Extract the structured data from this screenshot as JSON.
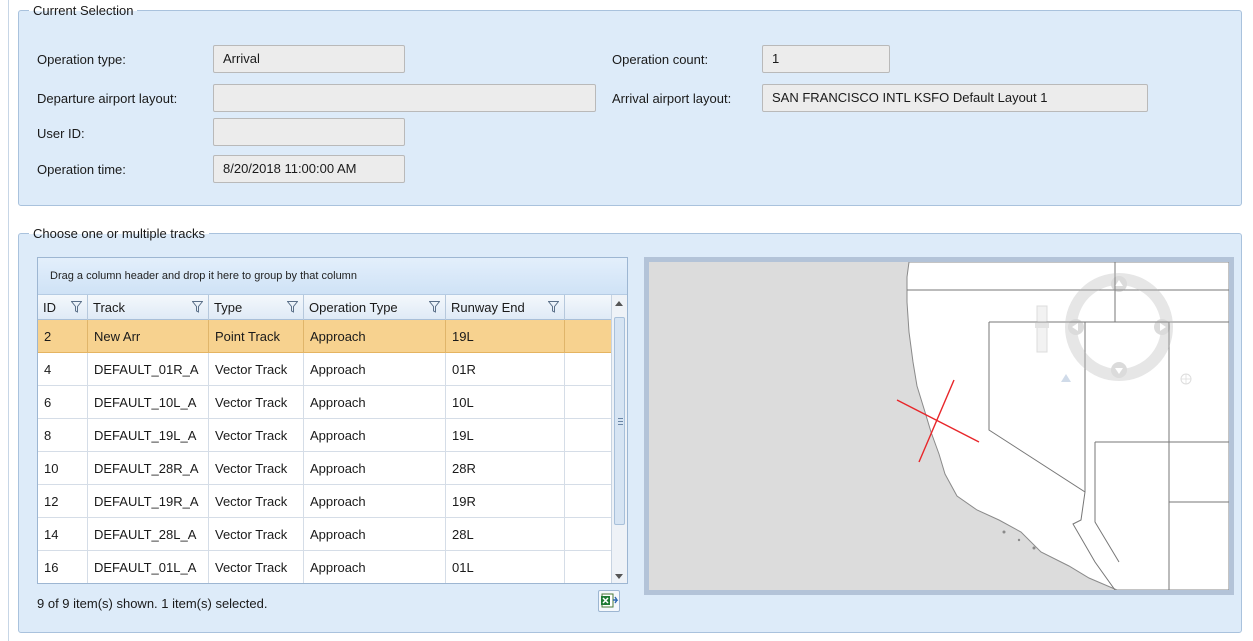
{
  "current_selection": {
    "title": "Current Selection",
    "operation_type_label": "Operation type:",
    "operation_type_value": "Arrival",
    "departure_layout_label": "Departure airport layout:",
    "departure_layout_value": "",
    "user_id_label": "User ID:",
    "user_id_value": "",
    "operation_time_label": "Operation time:",
    "operation_time_value": "8/20/2018 11:00:00 AM",
    "operation_count_label": "Operation count:",
    "operation_count_value": "1",
    "arrival_layout_label": "Arrival airport layout:",
    "arrival_layout_value": "SAN FRANCISCO INTL KSFO Default Layout 1"
  },
  "tracks": {
    "title": "Choose one or multiple tracks",
    "group_panel_text": "Drag a column header and drop it here to group by that column",
    "columns": [
      "ID",
      "Track",
      "Type",
      "Operation Type",
      "Runway End"
    ],
    "rows": [
      {
        "id": "2",
        "track": "New Arr",
        "type": "Point Track",
        "operation_type": "Approach",
        "runway_end": "19L",
        "selected": true
      },
      {
        "id": "4",
        "track": "DEFAULT_01R_A",
        "type": "Vector Track",
        "operation_type": "Approach",
        "runway_end": "01R",
        "selected": false
      },
      {
        "id": "6",
        "track": "DEFAULT_10L_A",
        "type": "Vector Track",
        "operation_type": "Approach",
        "runway_end": "10L",
        "selected": false
      },
      {
        "id": "8",
        "track": "DEFAULT_19L_A",
        "type": "Vector Track",
        "operation_type": "Approach",
        "runway_end": "19L",
        "selected": false
      },
      {
        "id": "10",
        "track": "DEFAULT_28R_A",
        "type": "Vector Track",
        "operation_type": "Approach",
        "runway_end": "28R",
        "selected": false
      },
      {
        "id": "12",
        "track": "DEFAULT_19R_A",
        "type": "Vector Track",
        "operation_type": "Approach",
        "runway_end": "19R",
        "selected": false
      },
      {
        "id": "14",
        "track": "DEFAULT_28L_A",
        "type": "Vector Track",
        "operation_type": "Approach",
        "runway_end": "28L",
        "selected": false
      },
      {
        "id": "16",
        "track": "DEFAULT_01L_A",
        "type": "Vector Track",
        "operation_type": "Approach",
        "runway_end": "01L",
        "selected": false
      }
    ],
    "status_text": "9 of 9 item(s) shown. 1 item(s) selected.",
    "export_icon": "excel-export-icon"
  },
  "map": {
    "icons": [
      "pan-control-icon",
      "zoom-slider-icon",
      "compass-icon"
    ],
    "track_color": "#e8262a"
  },
  "colors": {
    "panel_bg": "#ddebf9",
    "selected_row": "#f7d28f",
    "field_bg": "#ececec"
  }
}
